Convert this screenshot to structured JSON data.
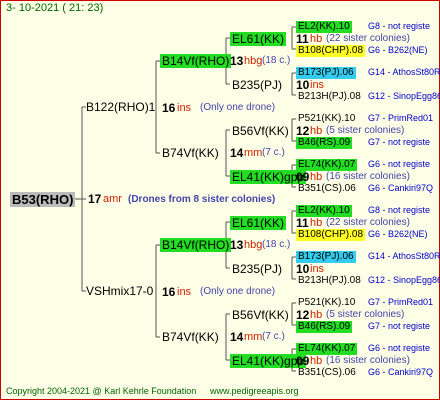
{
  "header": {
    "date": "3-  10-2021  (  21:  23)"
  },
  "footer": {
    "copyright": "Copyright 2004-2021 @ Karl Kehrle Foundation",
    "url": "www.pedigreeapis.org"
  },
  "root": {
    "label": "B53(RHO)",
    "num": "17",
    "code": "amr",
    "sisters": "(Drones from 8 sister colonies)"
  },
  "top": {
    "label": "B122(RHO)1",
    "num": "16",
    "code": "ins",
    "sisters": "(Only one drone)",
    "a": {
      "label": "B14Vf(RHO)",
      "num": "13",
      "code": "hbg",
      "sisters": "(18 c.)",
      "p1": {
        "label": "EL61(KK)",
        "l1": {
          "label": "EL2(KK).10",
          "ann": "G8 - not registe"
        },
        "num": "11",
        "code": "hb",
        "sisters": "(22 sister colonies)",
        "l2": {
          "label": "B108(CHP).08",
          "ann": "G6 - B262(NE)"
        }
      },
      "p2": {
        "label": "B235(PJ)",
        "l1": {
          "label": "B173(PJ).06",
          "ann": "G14 - AthosSt80R"
        },
        "num": "10",
        "code": "ins",
        "sisters": "",
        "l2": {
          "label": "B213H(PJ).08",
          "ann": "G12 - SinopEgg86R"
        }
      }
    },
    "b": {
      "label": "B74Vf(KK)",
      "num": "14",
      "code": "mm",
      "sisters": "(7 c.)",
      "p1": {
        "label": "B56Vf(KK)",
        "l1": {
          "label": "P521(KK).10",
          "ann": "G7 - PrimRed01"
        },
        "num": "12",
        "code": "hb",
        "sisters": "(5 sister colonies)",
        "l2": {
          "label": "B46(RS).09",
          "ann": "G7 - not registe"
        }
      },
      "p2": {
        "label": "EL41(KK)gpp",
        "l1": {
          "label": "EL74(KK).07",
          "ann": "G6 - not registe"
        },
        "num": "09",
        "code": "hb",
        "sisters": "(16 sister colonies)",
        "l2": {
          "label": "B351(CS).06",
          "ann": "G6 - Cankiri97Q"
        }
      }
    }
  },
  "bottom": {
    "label": "VSHmix17-0",
    "num": "16",
    "code": "ins",
    "sisters": "(Only one drone)",
    "a": {
      "label": "B14Vf(RHO)",
      "num": "13",
      "code": "hbg",
      "sisters": "(18 c.)",
      "p1": {
        "label": "EL61(KK)",
        "l1": {
          "label": "EL2(KK).10",
          "ann": "G8 - not registe"
        },
        "num": "11",
        "code": "hb",
        "sisters": "(22 sister colonies)",
        "l2": {
          "label": "B108(CHP).08",
          "ann": "G6 - B262(NE)"
        }
      },
      "p2": {
        "label": "B235(PJ)",
        "l1": {
          "label": "B173(PJ).06",
          "ann": "G14 - AthosSt80R"
        },
        "num": "10",
        "code": "ins",
        "sisters": "",
        "l2": {
          "label": "B213H(PJ).08",
          "ann": "G12 - SinopEgg86R"
        }
      }
    },
    "b": {
      "label": "B74Vf(KK)",
      "num": "14",
      "code": "mm",
      "sisters": "(7 c.)",
      "p1": {
        "label": "B56Vf(KK)",
        "l1": {
          "label": "P521(KK).10",
          "ann": "G7 - PrimRed01"
        },
        "num": "12",
        "code": "hb",
        "sisters": "(5 sister colonies)",
        "l2": {
          "label": "B46(RS).09",
          "ann": "G7 - not registe"
        }
      },
      "p2": {
        "label": "EL41(KK)gpp",
        "l1": {
          "label": "EL74(KK).07",
          "ann": "G6 - not registe"
        },
        "num": "09",
        "code": "hb",
        "sisters": "(16 sister colonies)",
        "l2": {
          "label": "B351(CS).06",
          "ann": "G6 - Cankiri97Q"
        }
      }
    }
  },
  "colors": {
    "green": "#22dd22",
    "yellow": "#ffff22",
    "cyan": "#33ccee",
    "grey": "#bbbbbb",
    "ann": "#0000cc",
    "code": "#cc2200",
    "sis": "#4444aa",
    "border": "#cc0000"
  }
}
